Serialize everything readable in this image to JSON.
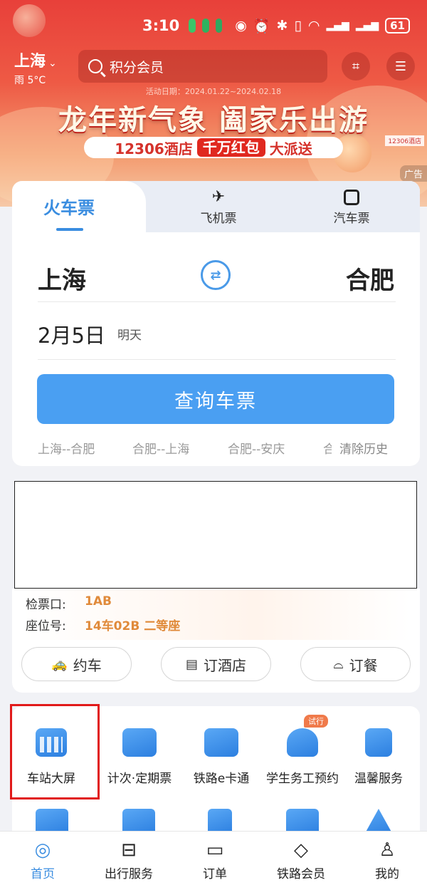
{
  "status_bar": {
    "time": "3:10",
    "battery": "61"
  },
  "header": {
    "city": "上海",
    "weather": "雨 5°C",
    "search_placeholder": "积分会员",
    "promo_date": "活动日期：2024.01.22~2024.02.18",
    "promo_title": "龙年新气象 阖家乐出游",
    "promo_sub_left": "12306酒店",
    "promo_sub_tag": "千万红包",
    "promo_sub_right": "大派送",
    "ad_label": "广告",
    "hotel_sign": "12306酒店"
  },
  "ticket": {
    "tabs": [
      {
        "label": "火车票",
        "icon": "train-icon"
      },
      {
        "label": "飞机票",
        "icon": "plane-icon"
      },
      {
        "label": "汽车票",
        "icon": "bus-icon"
      }
    ],
    "from": "上海",
    "to": "合肥",
    "date": "2月5日",
    "date_sub": "明天",
    "query_label": "查询车票",
    "history": [
      "上海--合肥",
      "合肥--上海",
      "合肥--安庆"
    ],
    "history_partial": "合",
    "clear_history": "清除历史"
  },
  "trip": {
    "gate_label": "检票口:",
    "gate_value": "1AB",
    "seat_label": "座位号:",
    "seat_value": "14车02B 二等座",
    "actions": [
      {
        "label": "约车",
        "icon": "car-icon"
      },
      {
        "label": "订酒店",
        "icon": "hotel-icon"
      },
      {
        "label": "订餐",
        "icon": "dining-icon"
      }
    ]
  },
  "services": [
    {
      "label": "车站大屏",
      "icon": "calendar-grid-icon"
    },
    {
      "label": "计次·定期票",
      "icon": "ticket-clock-icon"
    },
    {
      "label": "铁路e卡通",
      "icon": "card-icon"
    },
    {
      "label": "学生务工预约",
      "icon": "people-clock-icon",
      "badge": "试行"
    },
    {
      "label": "温馨服务",
      "icon": "heart-box-icon"
    }
  ],
  "nav": [
    {
      "label": "首页",
      "icon": "home-train-icon"
    },
    {
      "label": "出行服务",
      "icon": "luggage-icon"
    },
    {
      "label": "订单",
      "icon": "order-icon"
    },
    {
      "label": "铁路会员",
      "icon": "diamond-icon"
    },
    {
      "label": "我的",
      "icon": "person-icon"
    }
  ],
  "colors": {
    "accent": "#3a8de0",
    "query_button": "#4a9ff2",
    "highlight": "#e11a1a",
    "trip_value": "#e08a3a"
  }
}
